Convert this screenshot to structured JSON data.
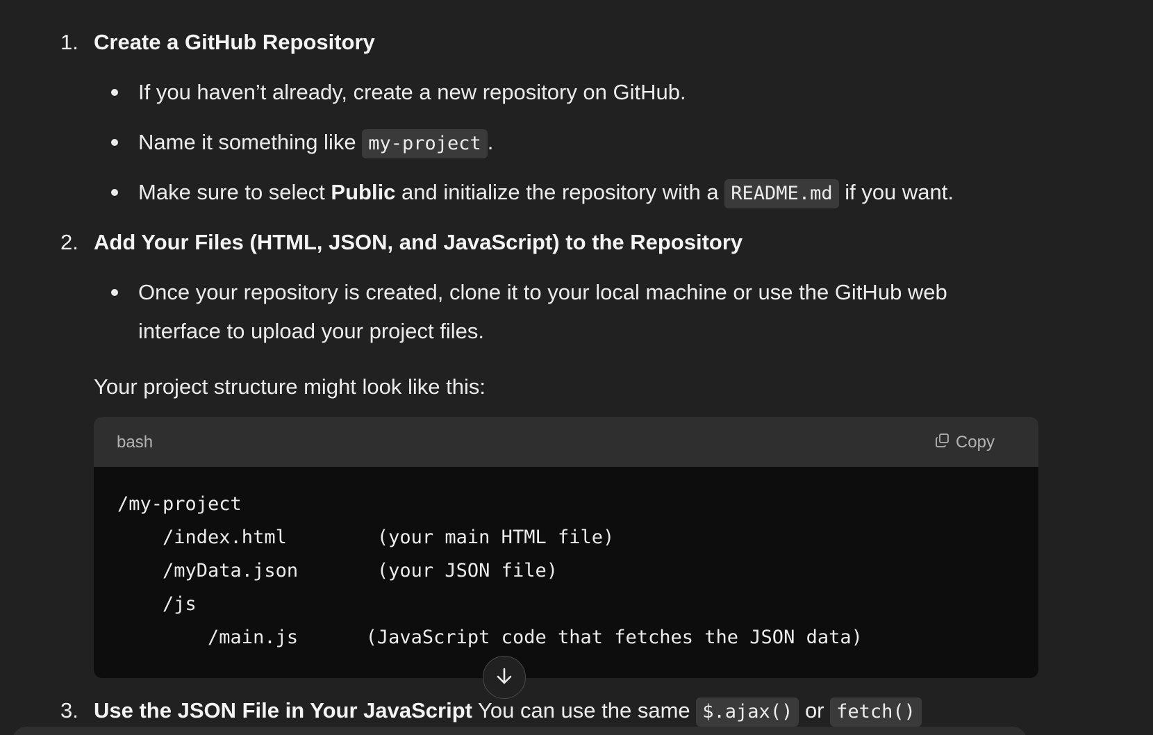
{
  "steps": [
    {
      "number": "1.",
      "title": "Create a GitHub Repository",
      "bullets": [
        {
          "text": "If you haven’t already, create a new repository on GitHub."
        },
        {
          "pre": "Name it something like ",
          "code": "my-project",
          "post": "."
        },
        {
          "pre": "Make sure to select ",
          "bold": "Public",
          "mid": " and initialize the repository with a ",
          "code": "README.md",
          "post": " if you want."
        }
      ]
    },
    {
      "number": "2.",
      "title": "Add Your Files (HTML, JSON, and JavaScript) to the Repository",
      "bullets": [
        {
          "line1": "Once your repository is created, clone it to your local machine or use the GitHub web",
          "line2": "interface to upload your project files."
        }
      ],
      "paragraph": "Your project structure might look like this:"
    },
    {
      "number": "3.",
      "title": "Use the JSON File in Your JavaScript",
      "tail_pre": " You can use the same ",
      "code1": "$.ajax()",
      "tail_mid": " or ",
      "code2": "fetch()"
    }
  ],
  "code_block": {
    "language": "bash",
    "copy_label": "Copy",
    "lines": [
      "/my-project",
      "    /index.html        (your main HTML file)",
      "    /myData.json       (your JSON file)",
      "    /js",
      "        /main.js      (JavaScript code that fetches the JSON data)"
    ]
  },
  "icons": {
    "copy": "copy-icon",
    "scroll": "arrow-down-icon"
  },
  "colors": {
    "background": "#212121",
    "code_background": "#0d0d0d",
    "code_header": "#2f2f2f",
    "inline_code": "#3a3a3a",
    "text": "#ececec"
  }
}
